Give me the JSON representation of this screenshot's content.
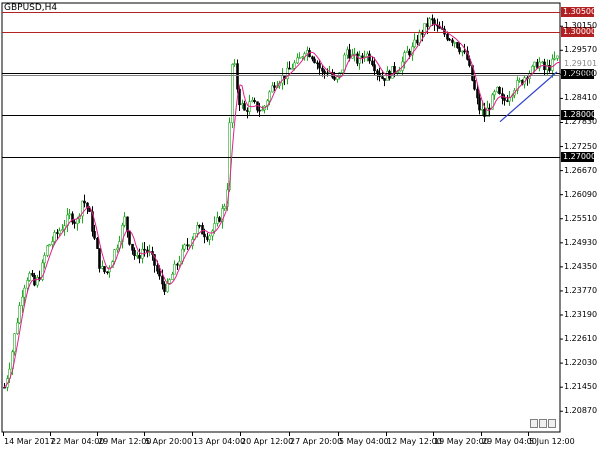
{
  "symbol": "GBPUSD,H4",
  "level_tags": [
    {
      "price": 1.305,
      "label": "1.30500",
      "color": "#b22222"
    },
    {
      "price": 1.3,
      "label": "1.30000",
      "color": "#b22222"
    },
    {
      "price": 1.29,
      "label": "1.29000",
      "color": "#000000"
    },
    {
      "price": 1.28,
      "label": "1.28000",
      "color": "#000000"
    },
    {
      "price": 1.27,
      "label": "1.27000",
      "color": "#000000"
    }
  ],
  "horizontal_lines": [
    {
      "price": 1.305,
      "color": "#b22222"
    },
    {
      "price": 1.3,
      "color": "#b22222"
    },
    {
      "price": 1.2902,
      "color": "#000000"
    },
    {
      "price": 1.2897,
      "color": "#808080"
    },
    {
      "price": 1.28,
      "color": "#000000"
    },
    {
      "price": 1.27,
      "color": "#000000"
    }
  ],
  "hidden_tag": "1.29101",
  "current_price": 1.2911,
  "colors": {
    "bull": "#22aa22",
    "bear": "#000000",
    "ma": "#e0208a",
    "trendline": "#3344cc",
    "axis": "#000000"
  },
  "chart_data": {
    "type": "candlestick",
    "symbol": "GBPUSD",
    "timeframe": "H4",
    "y_range": [
      1.2037,
      1.3071
    ],
    "y_ticks": [
      "1.30150",
      "1.29570",
      "1.28990",
      "1.28410",
      "1.27830",
      "1.27250",
      "1.26670",
      "1.26090",
      "1.25510",
      "1.24930",
      "1.24350",
      "1.23770",
      "1.23190",
      "1.22610",
      "1.22030",
      "1.21450",
      "1.20870"
    ],
    "x_ticks": [
      "14 Mar 2017",
      "22 Mar 04:00",
      "29 Mar 12:00",
      "5 Apr 20:00",
      "13 Apr 04:00",
      "20 Apr 12:00",
      "27 Apr 20:00",
      "5 May 04:00",
      "12 May 12:00",
      "19 May 20:00",
      "29 May 04:00",
      "5 Jun 12:00"
    ],
    "close_path": [
      [
        0,
        1.2145
      ],
      [
        6,
        1.221
      ],
      [
        12,
        1.23
      ],
      [
        18,
        1.238
      ],
      [
        24,
        1.242
      ],
      [
        30,
        1.239
      ],
      [
        36,
        1.242
      ],
      [
        42,
        1.248
      ],
      [
        48,
        1.25
      ],
      [
        54,
        1.252
      ],
      [
        60,
        1.254
      ],
      [
        66,
        1.256
      ],
      [
        72,
        1.254
      ],
      [
        78,
        1.26
      ],
      [
        84,
        1.257
      ],
      [
        90,
        1.25
      ],
      [
        96,
        1.243
      ],
      [
        102,
        1.242
      ],
      [
        108,
        1.246
      ],
      [
        114,
        1.25
      ],
      [
        120,
        1.255
      ],
      [
        126,
        1.249
      ],
      [
        132,
        1.245
      ],
      [
        138,
        1.248
      ],
      [
        144,
        1.247
      ],
      [
        150,
        1.244
      ],
      [
        156,
        1.24
      ],
      [
        162,
        1.238
      ],
      [
        168,
        1.242
      ],
      [
        174,
        1.245
      ],
      [
        180,
        1.248
      ],
      [
        186,
        1.25
      ],
      [
        192,
        1.253
      ],
      [
        198,
        1.252
      ],
      [
        204,
        1.251
      ],
      [
        210,
        1.253
      ],
      [
        216,
        1.256
      ],
      [
        222,
        1.26
      ],
      [
        228,
        1.295
      ],
      [
        234,
        1.284
      ],
      [
        240,
        1.281
      ],
      [
        246,
        1.283
      ],
      [
        252,
        1.282
      ],
      [
        258,
        1.281
      ],
      [
        264,
        1.285
      ],
      [
        270,
        1.288
      ],
      [
        276,
        1.289
      ],
      [
        282,
        1.29
      ],
      [
        288,
        1.292
      ],
      [
        294,
        1.293
      ],
      [
        300,
        1.296
      ],
      [
        306,
        1.295
      ],
      [
        312,
        1.293
      ],
      [
        318,
        1.29
      ],
      [
        324,
        1.291
      ],
      [
        330,
        1.288
      ],
      [
        336,
        1.29
      ],
      [
        342,
        1.296
      ],
      [
        348,
        1.294
      ],
      [
        354,
        1.293
      ],
      [
        360,
        1.295
      ],
      [
        366,
        1.294
      ],
      [
        372,
        1.291
      ],
      [
        378,
        1.289
      ],
      [
        384,
        1.29
      ],
      [
        390,
        1.291
      ],
      [
        396,
        1.292
      ],
      [
        402,
        1.295
      ],
      [
        408,
        1.296
      ],
      [
        414,
        1.299
      ],
      [
        420,
        1.301
      ],
      [
        426,
        1.303
      ],
      [
        432,
        1.301
      ],
      [
        438,
        1.3
      ],
      [
        444,
        1.299
      ],
      [
        450,
        1.298
      ],
      [
        456,
        1.296
      ],
      [
        462,
        1.294
      ],
      [
        468,
        1.288
      ],
      [
        474,
        1.282
      ],
      [
        480,
        1.28
      ],
      [
        486,
        1.283
      ],
      [
        492,
        1.286
      ],
      [
        498,
        1.283
      ],
      [
        504,
        1.285
      ],
      [
        510,
        1.287
      ],
      [
        516,
        1.288
      ],
      [
        522,
        1.29
      ],
      [
        528,
        1.291
      ],
      [
        534,
        1.293
      ],
      [
        540,
        1.291
      ],
      [
        546,
        1.292
      ],
      [
        552,
        1.294
      ],
      [
        557,
        1.2911
      ]
    ],
    "trendline": [
      [
        500,
        1.2785
      ],
      [
        557,
        1.2905
      ]
    ]
  }
}
